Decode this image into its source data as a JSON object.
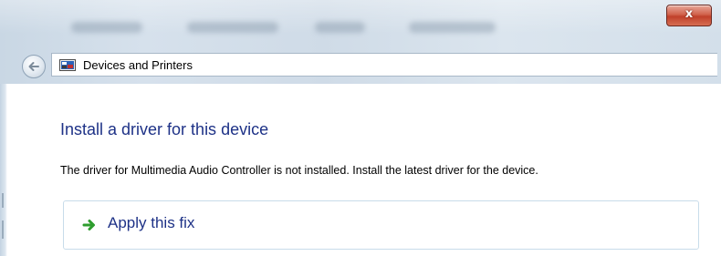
{
  "window": {
    "close_glyph": "x"
  },
  "address": {
    "location": "Devices and Printers",
    "icon": "devices-printers-icon"
  },
  "main": {
    "heading": "Install a driver for this device",
    "description": "The driver for Multimedia Audio Controller is not installed. Install the latest driver for the device.",
    "fix_label": "Apply this fix",
    "fix_icon": "green-arrow-icon"
  },
  "colors": {
    "heading": "#1e3287",
    "close_button": "#c0402a",
    "fix_arrow": "#2e9d2e",
    "fix_border": "#c8dcea"
  }
}
